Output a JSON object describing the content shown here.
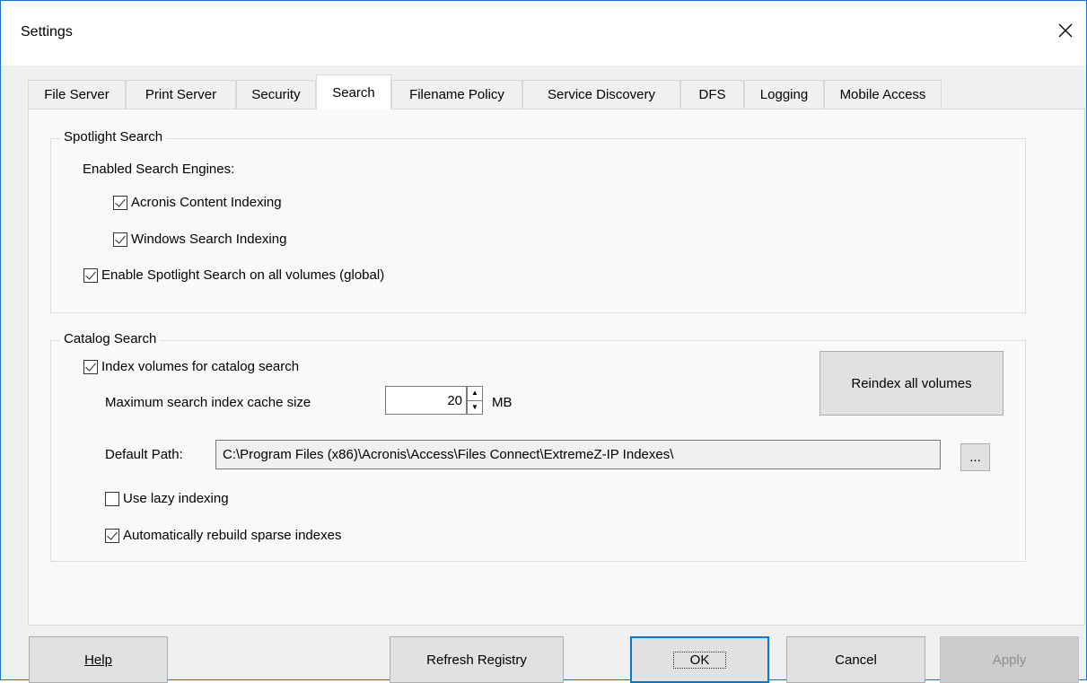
{
  "window": {
    "title": "Settings"
  },
  "tabs": [
    {
      "label": "File Server"
    },
    {
      "label": "Print Server"
    },
    {
      "label": "Security"
    },
    {
      "label": "Search",
      "active": true
    },
    {
      "label": "Filename Policy"
    },
    {
      "label": "Service Discovery"
    },
    {
      "label": "DFS"
    },
    {
      "label": "Logging"
    },
    {
      "label": "Mobile Access"
    }
  ],
  "spotlight": {
    "group_label": "Spotlight Search",
    "engines_label": "Enabled Search Engines:",
    "acronis": {
      "label": "Acronis Content Indexing",
      "checked": true
    },
    "windows": {
      "label": "Windows Search Indexing",
      "checked": true
    },
    "global": {
      "label": "Enable Spotlight Search on all volumes (global)",
      "checked": true
    }
  },
  "catalog": {
    "group_label": "Catalog Search",
    "index_volumes": {
      "label": "Index volumes for catalog search",
      "checked": true
    },
    "reindex_button": "Reindex all volumes",
    "cache_label": "Maximum search index cache size",
    "cache_value": "20",
    "cache_unit": "MB",
    "path_label": "Default Path:",
    "path_value": "C:\\Program Files (x86)\\Acronis\\Access\\Files Connect\\ExtremeZ-IP Indexes\\",
    "browse_button": "...",
    "lazy": {
      "label": "Use lazy indexing",
      "checked": false
    },
    "rebuild": {
      "label": "Automatically rebuild sparse indexes",
      "checked": true
    }
  },
  "buttons": {
    "help": "Help",
    "refresh": "Refresh Registry",
    "ok": "OK",
    "cancel": "Cancel",
    "apply": "Apply"
  },
  "colors": {
    "accent": "#0078d7",
    "dialog_bg": "#f0f0f0",
    "panel_bg": "#f9f9f9"
  }
}
